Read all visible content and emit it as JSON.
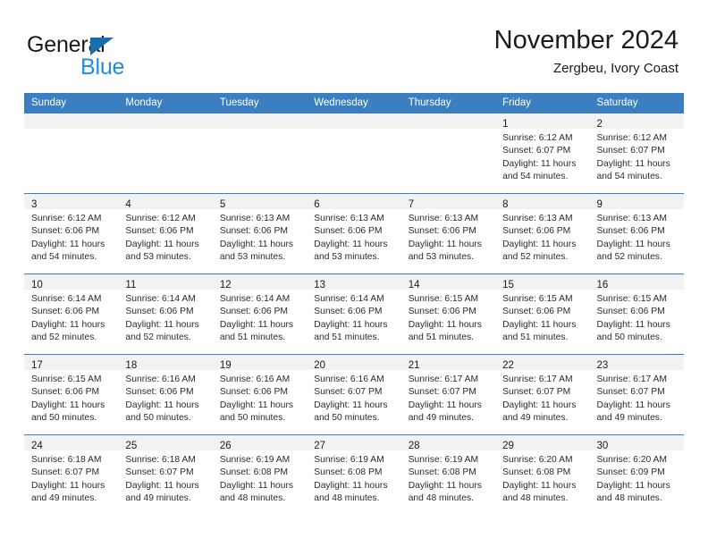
{
  "brand": {
    "name_part1": "General",
    "name_part2": "Blue",
    "triangle_color": "#1a6dad",
    "blue_color": "#1a8fe0"
  },
  "header": {
    "title": "November 2024",
    "subtitle": "Zergbeu, Ivory Coast"
  },
  "theme": {
    "header_blue": "#3c7fc1",
    "daynum_band": "#f2f2f2",
    "text": "#2b2b2b"
  },
  "weekday_headers": [
    "Sunday",
    "Monday",
    "Tuesday",
    "Wednesday",
    "Thursday",
    "Friday",
    "Saturday"
  ],
  "weeks": [
    [
      {
        "day": "",
        "sunrise": "",
        "sunset": "",
        "daylight_line1": "",
        "daylight_line2": ""
      },
      {
        "day": "",
        "sunrise": "",
        "sunset": "",
        "daylight_line1": "",
        "daylight_line2": ""
      },
      {
        "day": "",
        "sunrise": "",
        "sunset": "",
        "daylight_line1": "",
        "daylight_line2": ""
      },
      {
        "day": "",
        "sunrise": "",
        "sunset": "",
        "daylight_line1": "",
        "daylight_line2": ""
      },
      {
        "day": "",
        "sunrise": "",
        "sunset": "",
        "daylight_line1": "",
        "daylight_line2": ""
      },
      {
        "day": "1",
        "sunrise": "Sunrise: 6:12 AM",
        "sunset": "Sunset: 6:07 PM",
        "daylight_line1": "Daylight: 11 hours",
        "daylight_line2": "and 54 minutes."
      },
      {
        "day": "2",
        "sunrise": "Sunrise: 6:12 AM",
        "sunset": "Sunset: 6:07 PM",
        "daylight_line1": "Daylight: 11 hours",
        "daylight_line2": "and 54 minutes."
      }
    ],
    [
      {
        "day": "3",
        "sunrise": "Sunrise: 6:12 AM",
        "sunset": "Sunset: 6:06 PM",
        "daylight_line1": "Daylight: 11 hours",
        "daylight_line2": "and 54 minutes."
      },
      {
        "day": "4",
        "sunrise": "Sunrise: 6:12 AM",
        "sunset": "Sunset: 6:06 PM",
        "daylight_line1": "Daylight: 11 hours",
        "daylight_line2": "and 53 minutes."
      },
      {
        "day": "5",
        "sunrise": "Sunrise: 6:13 AM",
        "sunset": "Sunset: 6:06 PM",
        "daylight_line1": "Daylight: 11 hours",
        "daylight_line2": "and 53 minutes."
      },
      {
        "day": "6",
        "sunrise": "Sunrise: 6:13 AM",
        "sunset": "Sunset: 6:06 PM",
        "daylight_line1": "Daylight: 11 hours",
        "daylight_line2": "and 53 minutes."
      },
      {
        "day": "7",
        "sunrise": "Sunrise: 6:13 AM",
        "sunset": "Sunset: 6:06 PM",
        "daylight_line1": "Daylight: 11 hours",
        "daylight_line2": "and 53 minutes."
      },
      {
        "day": "8",
        "sunrise": "Sunrise: 6:13 AM",
        "sunset": "Sunset: 6:06 PM",
        "daylight_line1": "Daylight: 11 hours",
        "daylight_line2": "and 52 minutes."
      },
      {
        "day": "9",
        "sunrise": "Sunrise: 6:13 AM",
        "sunset": "Sunset: 6:06 PM",
        "daylight_line1": "Daylight: 11 hours",
        "daylight_line2": "and 52 minutes."
      }
    ],
    [
      {
        "day": "10",
        "sunrise": "Sunrise: 6:14 AM",
        "sunset": "Sunset: 6:06 PM",
        "daylight_line1": "Daylight: 11 hours",
        "daylight_line2": "and 52 minutes."
      },
      {
        "day": "11",
        "sunrise": "Sunrise: 6:14 AM",
        "sunset": "Sunset: 6:06 PM",
        "daylight_line1": "Daylight: 11 hours",
        "daylight_line2": "and 52 minutes."
      },
      {
        "day": "12",
        "sunrise": "Sunrise: 6:14 AM",
        "sunset": "Sunset: 6:06 PM",
        "daylight_line1": "Daylight: 11 hours",
        "daylight_line2": "and 51 minutes."
      },
      {
        "day": "13",
        "sunrise": "Sunrise: 6:14 AM",
        "sunset": "Sunset: 6:06 PM",
        "daylight_line1": "Daylight: 11 hours",
        "daylight_line2": "and 51 minutes."
      },
      {
        "day": "14",
        "sunrise": "Sunrise: 6:15 AM",
        "sunset": "Sunset: 6:06 PM",
        "daylight_line1": "Daylight: 11 hours",
        "daylight_line2": "and 51 minutes."
      },
      {
        "day": "15",
        "sunrise": "Sunrise: 6:15 AM",
        "sunset": "Sunset: 6:06 PM",
        "daylight_line1": "Daylight: 11 hours",
        "daylight_line2": "and 51 minutes."
      },
      {
        "day": "16",
        "sunrise": "Sunrise: 6:15 AM",
        "sunset": "Sunset: 6:06 PM",
        "daylight_line1": "Daylight: 11 hours",
        "daylight_line2": "and 50 minutes."
      }
    ],
    [
      {
        "day": "17",
        "sunrise": "Sunrise: 6:15 AM",
        "sunset": "Sunset: 6:06 PM",
        "daylight_line1": "Daylight: 11 hours",
        "daylight_line2": "and 50 minutes."
      },
      {
        "day": "18",
        "sunrise": "Sunrise: 6:16 AM",
        "sunset": "Sunset: 6:06 PM",
        "daylight_line1": "Daylight: 11 hours",
        "daylight_line2": "and 50 minutes."
      },
      {
        "day": "19",
        "sunrise": "Sunrise: 6:16 AM",
        "sunset": "Sunset: 6:06 PM",
        "daylight_line1": "Daylight: 11 hours",
        "daylight_line2": "and 50 minutes."
      },
      {
        "day": "20",
        "sunrise": "Sunrise: 6:16 AM",
        "sunset": "Sunset: 6:07 PM",
        "daylight_line1": "Daylight: 11 hours",
        "daylight_line2": "and 50 minutes."
      },
      {
        "day": "21",
        "sunrise": "Sunrise: 6:17 AM",
        "sunset": "Sunset: 6:07 PM",
        "daylight_line1": "Daylight: 11 hours",
        "daylight_line2": "and 49 minutes."
      },
      {
        "day": "22",
        "sunrise": "Sunrise: 6:17 AM",
        "sunset": "Sunset: 6:07 PM",
        "daylight_line1": "Daylight: 11 hours",
        "daylight_line2": "and 49 minutes."
      },
      {
        "day": "23",
        "sunrise": "Sunrise: 6:17 AM",
        "sunset": "Sunset: 6:07 PM",
        "daylight_line1": "Daylight: 11 hours",
        "daylight_line2": "and 49 minutes."
      }
    ],
    [
      {
        "day": "24",
        "sunrise": "Sunrise: 6:18 AM",
        "sunset": "Sunset: 6:07 PM",
        "daylight_line1": "Daylight: 11 hours",
        "daylight_line2": "and 49 minutes."
      },
      {
        "day": "25",
        "sunrise": "Sunrise: 6:18 AM",
        "sunset": "Sunset: 6:07 PM",
        "daylight_line1": "Daylight: 11 hours",
        "daylight_line2": "and 49 minutes."
      },
      {
        "day": "26",
        "sunrise": "Sunrise: 6:19 AM",
        "sunset": "Sunset: 6:08 PM",
        "daylight_line1": "Daylight: 11 hours",
        "daylight_line2": "and 48 minutes."
      },
      {
        "day": "27",
        "sunrise": "Sunrise: 6:19 AM",
        "sunset": "Sunset: 6:08 PM",
        "daylight_line1": "Daylight: 11 hours",
        "daylight_line2": "and 48 minutes."
      },
      {
        "day": "28",
        "sunrise": "Sunrise: 6:19 AM",
        "sunset": "Sunset: 6:08 PM",
        "daylight_line1": "Daylight: 11 hours",
        "daylight_line2": "and 48 minutes."
      },
      {
        "day": "29",
        "sunrise": "Sunrise: 6:20 AM",
        "sunset": "Sunset: 6:08 PM",
        "daylight_line1": "Daylight: 11 hours",
        "daylight_line2": "and 48 minutes."
      },
      {
        "day": "30",
        "sunrise": "Sunrise: 6:20 AM",
        "sunset": "Sunset: 6:09 PM",
        "daylight_line1": "Daylight: 11 hours",
        "daylight_line2": "and 48 minutes."
      }
    ]
  ]
}
